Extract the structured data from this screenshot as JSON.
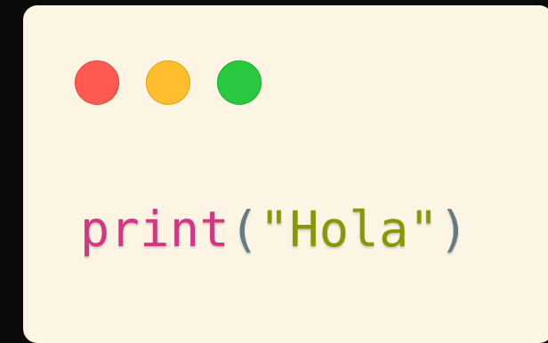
{
  "window": {
    "buttons": [
      {
        "name": "close",
        "color": "#ff5a52"
      },
      {
        "name": "minimize",
        "color": "#ffbe2e"
      },
      {
        "name": "maximize",
        "color": "#28c840"
      }
    ]
  },
  "code": {
    "tokens": {
      "function": "print",
      "open_paren": "(",
      "string": "\"Hola\"",
      "close_paren": ")"
    },
    "colors": {
      "function": "#d33682",
      "punctuation": "#657b83",
      "string": "#859900"
    }
  }
}
